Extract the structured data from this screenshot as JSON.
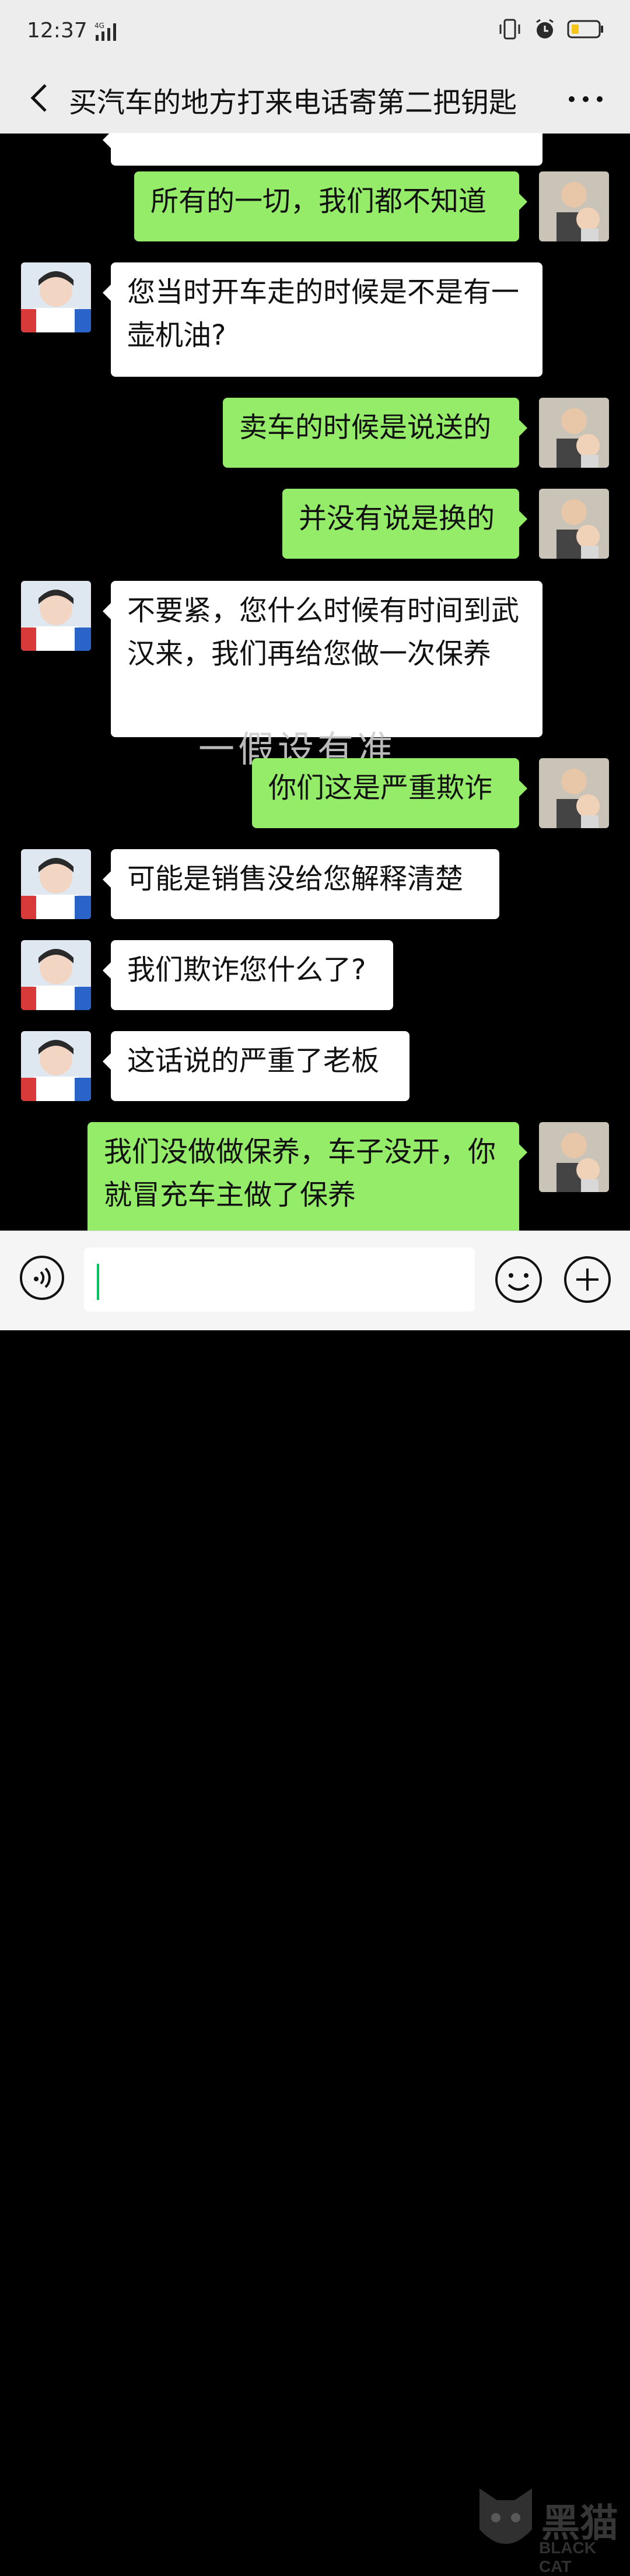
{
  "status_bar": {
    "time": "12:37",
    "network": "4G"
  },
  "header": {
    "title": "买汽车的地方打来电话寄第二把钥匙"
  },
  "messages": [
    {
      "side": "out",
      "text": "所有的一切，我们都不知道"
    },
    {
      "side": "in",
      "text": "您当时开车走的时候是不是有一壶机油?"
    },
    {
      "side": "out",
      "text": "卖车的时候是说送的"
    },
    {
      "side": "out",
      "text": "并没有说是换的"
    },
    {
      "side": "in",
      "text": "不要紧，您什么时候有时间到武汉来，我们再给您做一次保养"
    },
    {
      "side": "out",
      "text": "你们这是严重欺诈"
    },
    {
      "side": "in",
      "text": "可能是销售没给您解释清楚"
    },
    {
      "side": "in",
      "text": "我们欺诈您什么了?"
    },
    {
      "side": "in",
      "text": "这话说的严重了老板"
    },
    {
      "side": "out",
      "text": "我们没做做保养，车子没开，你就冒充车主做了保养"
    }
  ],
  "background_overlay_text": "一假设有准",
  "watermark": {
    "cn": "黑猫",
    "en": "BLACK CAT"
  },
  "colors": {
    "out_bubble": "#95ec69",
    "in_bubble": "#ffffff",
    "chat_bg": "#000000",
    "bars": "#ededed"
  }
}
